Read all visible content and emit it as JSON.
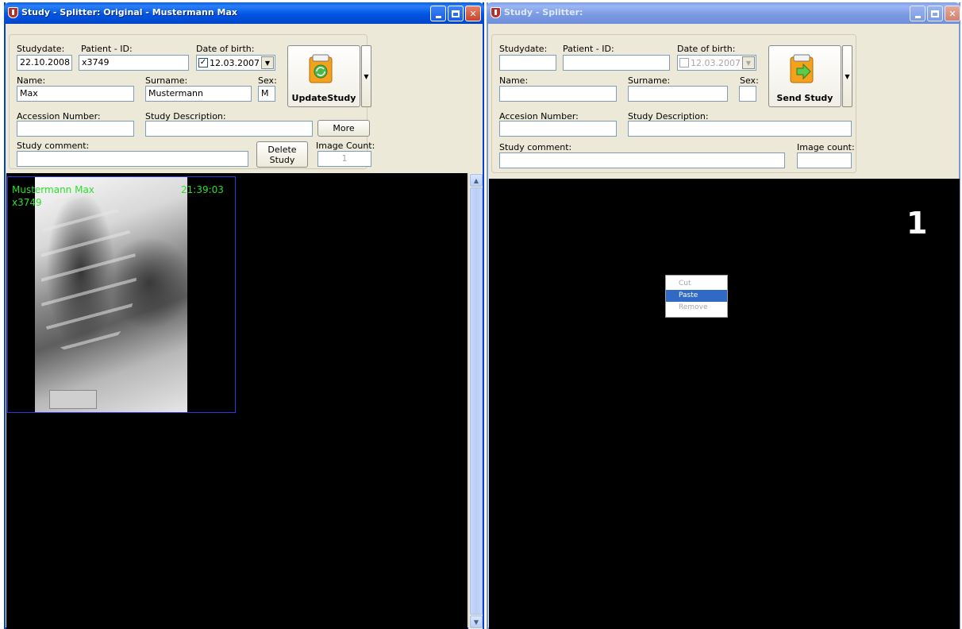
{
  "left_window": {
    "title": "Study - Splitter: Original - Mustermann Max",
    "form": {
      "studydate_label": "Studydate:",
      "studydate_value": "22.10.2008",
      "patient_id_label": "Patient - ID:",
      "patient_id_value": "x3749",
      "dob_label": "Date of birth:",
      "dob_value": "12.03.2007",
      "dob_checked_glyph": "✓",
      "name_label": "Name:",
      "name_value": "Max",
      "surname_label": "Surname:",
      "surname_value": "Mustermann",
      "sex_label": "Sex:",
      "sex_value": "M",
      "accession_label": "Accession Number:",
      "accession_value": "",
      "description_label": "Study Description:",
      "description_value": "",
      "comment_label": "Study comment:",
      "comment_value": "",
      "image_count_label": "Image Count:",
      "image_count_value": "1"
    },
    "buttons": {
      "update_study": "UpdateStudy",
      "more": "More",
      "delete_study": "Delete Study"
    },
    "viewer": {
      "overlay_name": "Mustermann Max",
      "overlay_id": "x3749",
      "overlay_time": "21:39:03"
    }
  },
  "right_window": {
    "title": "Study - Splitter:",
    "form": {
      "studydate_label": "Studydate:",
      "studydate_value": "",
      "patient_id_label": "Patient - ID:",
      "patient_id_value": "",
      "dob_label": "Date of birth:",
      "dob_value": "12.03.2007",
      "name_label": "Name:",
      "name_value": "",
      "surname_label": "Surname:",
      "surname_value": "",
      "sex_label": "Sex:",
      "sex_value": "",
      "accession_label": "Accesion Number:",
      "accession_value": "",
      "description_label": "Study Description:",
      "description_value": "",
      "comment_label": "Study comment:",
      "comment_value": "",
      "image_count_label": "Image count:",
      "image_count_value": ""
    },
    "buttons": {
      "send_study": "Send Study"
    },
    "viewer": {
      "panel_number": "1"
    },
    "context_menu": {
      "items": [
        "Cut",
        "Paste",
        "Remove"
      ],
      "highlighted": "Paste"
    }
  },
  "colors": {
    "active_title": "#0054e3",
    "inactive_title": "#7c9be3",
    "overlay_text": "#2adf2a",
    "menu_highlight": "#316ac5"
  },
  "icons": {
    "app": "app-shield-icon",
    "update": "clipboard-recycle-icon",
    "send": "clipboard-arrow-icon"
  }
}
